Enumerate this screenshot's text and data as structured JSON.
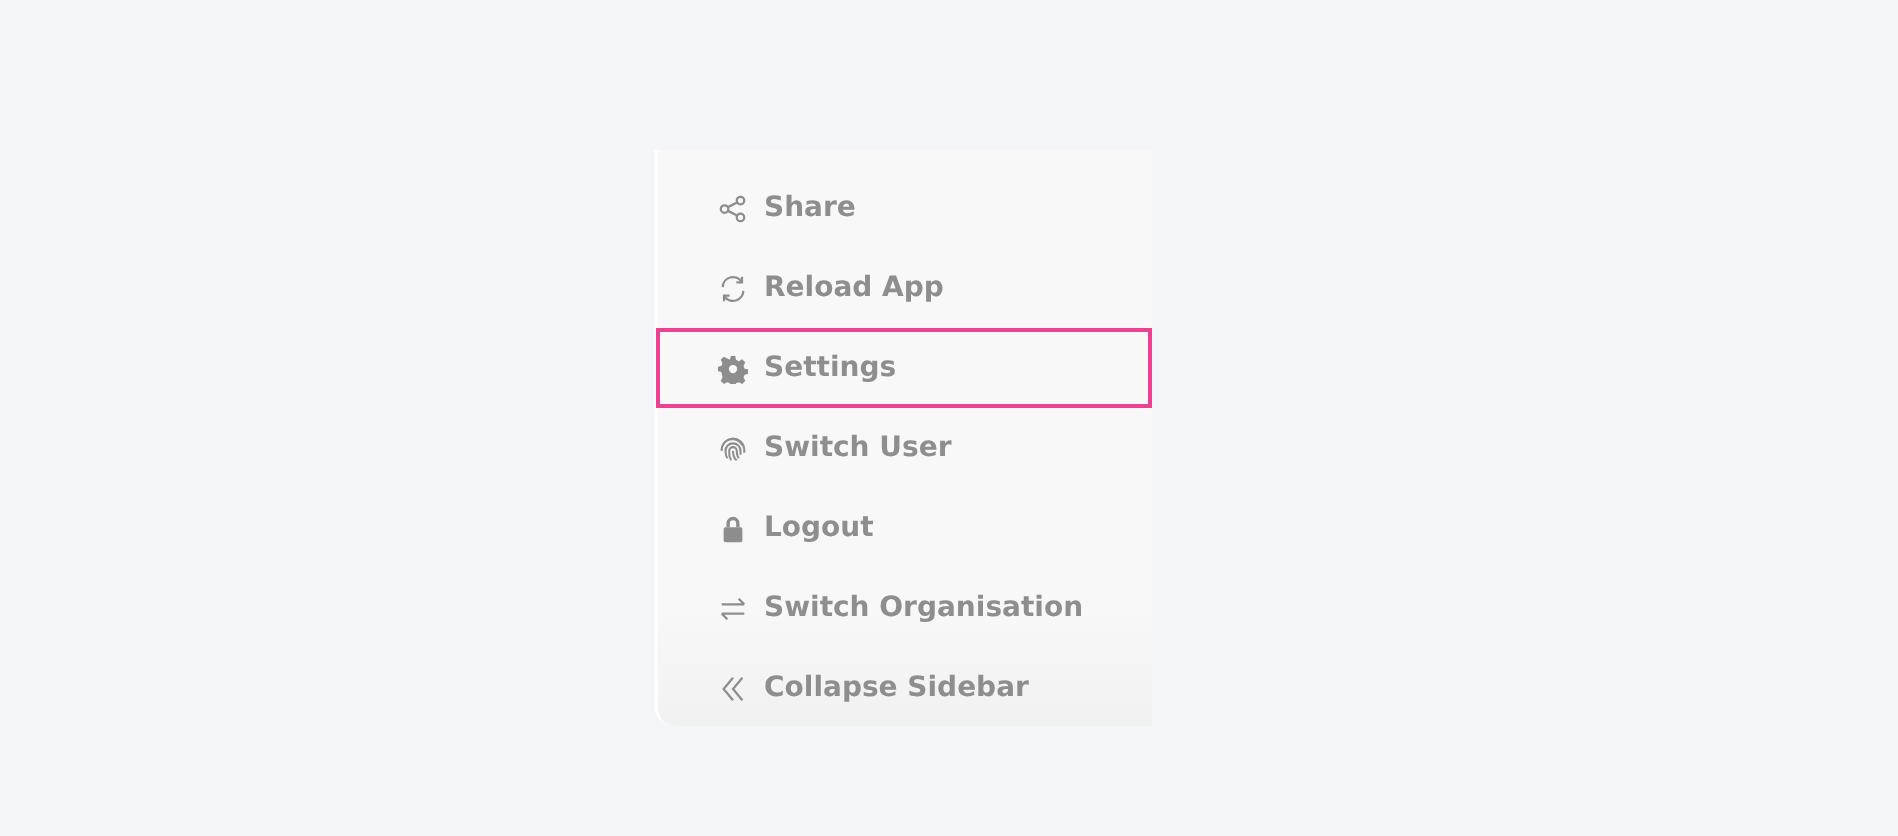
{
  "menu": {
    "items": [
      {
        "label": "Share",
        "kind": "share",
        "selected": false
      },
      {
        "label": "Reload App",
        "kind": "reload",
        "selected": false
      },
      {
        "label": "Settings",
        "kind": "settings",
        "selected": true
      },
      {
        "label": "Switch User",
        "kind": "fingerprint",
        "selected": false
      },
      {
        "label": "Logout",
        "kind": "lock",
        "selected": false
      },
      {
        "label": "Switch Organisation",
        "kind": "swap",
        "selected": false
      },
      {
        "label": "Collapse Sidebar",
        "kind": "collapse",
        "selected": false
      }
    ]
  }
}
